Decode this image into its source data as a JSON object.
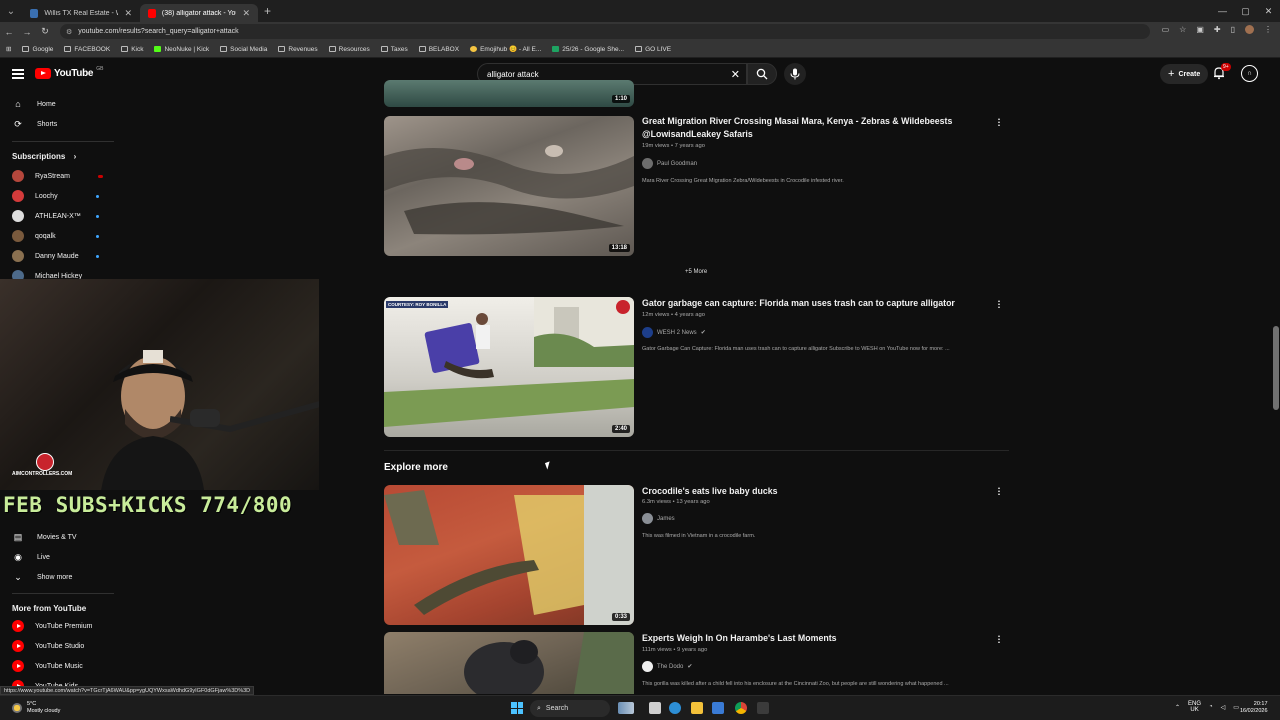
{
  "browser": {
    "tabs": [
      {
        "title": "Willis TX Real Estate - Willis TX",
        "active": false
      },
      {
        "title": "(38) alligator attack - YouTube",
        "active": true
      }
    ],
    "url": "youtube.com/results?search_query=alligator+attack",
    "bookmarks": [
      "Google",
      "FACEBOOK",
      "Kick",
      "NeoNuke | Kick",
      "Social Media",
      "Revenues",
      "Resources",
      "Taxes",
      "BELABOX",
      "Emojihub 😊 - All E...",
      "25/26 - Google She...",
      "GO LIVE"
    ],
    "status_url": "https://www.youtube.com/watch?v=TGcrTjA6WAU&pp=ygUQYWxsaWdhdG9yIGF0dGFjaw%3D%3D"
  },
  "header": {
    "logo_text": "YouTube",
    "logo_region": "GB",
    "search_value": "alligator attack",
    "create_label": "Create",
    "notification_badge": "9+"
  },
  "sidebar": {
    "main": [
      {
        "label": "Home",
        "icon": "home-icon"
      },
      {
        "label": "Shorts",
        "icon": "shorts-icon"
      }
    ],
    "subscriptions_heading": "Subscriptions",
    "subscriptions": [
      {
        "label": "RyaStream",
        "color": "#b5473c",
        "indicator": "red"
      },
      {
        "label": "Loochy",
        "color": "#d43b3b",
        "indicator": "live"
      },
      {
        "label": "ATHLEAN-X™",
        "color": "#dddddd",
        "indicator": "live"
      },
      {
        "label": "qoqalk",
        "color": "#7a5a3d",
        "indicator": "live"
      },
      {
        "label": "Danny Maude",
        "color": "#8a7050",
        "indicator": "live"
      },
      {
        "label": "Michael Hickey",
        "color": "#4d6a8a",
        "indicator": "none"
      }
    ],
    "explore_items": [
      {
        "label": "Movies & TV",
        "icon": "clapperboard-icon"
      },
      {
        "label": "Live",
        "icon": "live-icon"
      },
      {
        "label": "Show more",
        "icon": "chevron-down-icon"
      }
    ],
    "more_heading": "More from YouTube",
    "more_items": [
      "YouTube Premium",
      "YouTube Studio",
      "YouTube Music",
      "YouTube Kids"
    ]
  },
  "overlay": {
    "webcam_brand": "AIMCONTROLLERS.COM",
    "subgoal_text": "FEB SUBS+KICKS 774/800"
  },
  "results": {
    "top_partial_duration": "1:10",
    "videos": [
      {
        "title": "Great Migration River Crossing Masai Mara, Kenya - Zebras & Wildebeests @LowisandLeakey Safaris",
        "meta": "19m views • 7 years ago",
        "channel": "Paul Goodman",
        "verified": false,
        "description": "Mara River Crossing Great Migration Zebra/Wildebeests in Crocodile infested river.",
        "duration": "13:18"
      },
      {
        "title": "Gator garbage can capture: Florida man uses trash can to capture alligator",
        "meta": "12m views • 4 years ago",
        "channel": "WESH 2 News",
        "verified": true,
        "description": "Gator Garbage Can Capture: Florida man uses trash can to capture alligator Subscribe to WESH on YouTube now for more: ...",
        "duration": "2:40",
        "thumb_badge": "COURTESY: ROY BONILLA"
      }
    ],
    "more_label": "+5 More",
    "explore_heading": "Explore more",
    "explore_videos": [
      {
        "title": "Crocodile's eats live baby ducks",
        "meta": "6.3m views • 13 years ago",
        "channel": "James",
        "verified": false,
        "description": "This was filmed in Vietnam in a crocodile farm.",
        "duration": "0:33"
      },
      {
        "title": "Experts Weigh In On Harambe's Last Moments",
        "meta": "111m views • 9 years ago",
        "channel": "The Dodo",
        "verified": true,
        "description": "This gorilla was killed after a child fell into his enclosure at the Cincinnati Zoo, but people are still wondering what happened ..."
      }
    ]
  },
  "taskbar": {
    "weather_temp": "5°C",
    "weather_desc": "Mostly cloudy",
    "search_label": "Search",
    "lang": "ENG",
    "region": "UK",
    "time": "20:17",
    "date": "16/02/2026"
  }
}
